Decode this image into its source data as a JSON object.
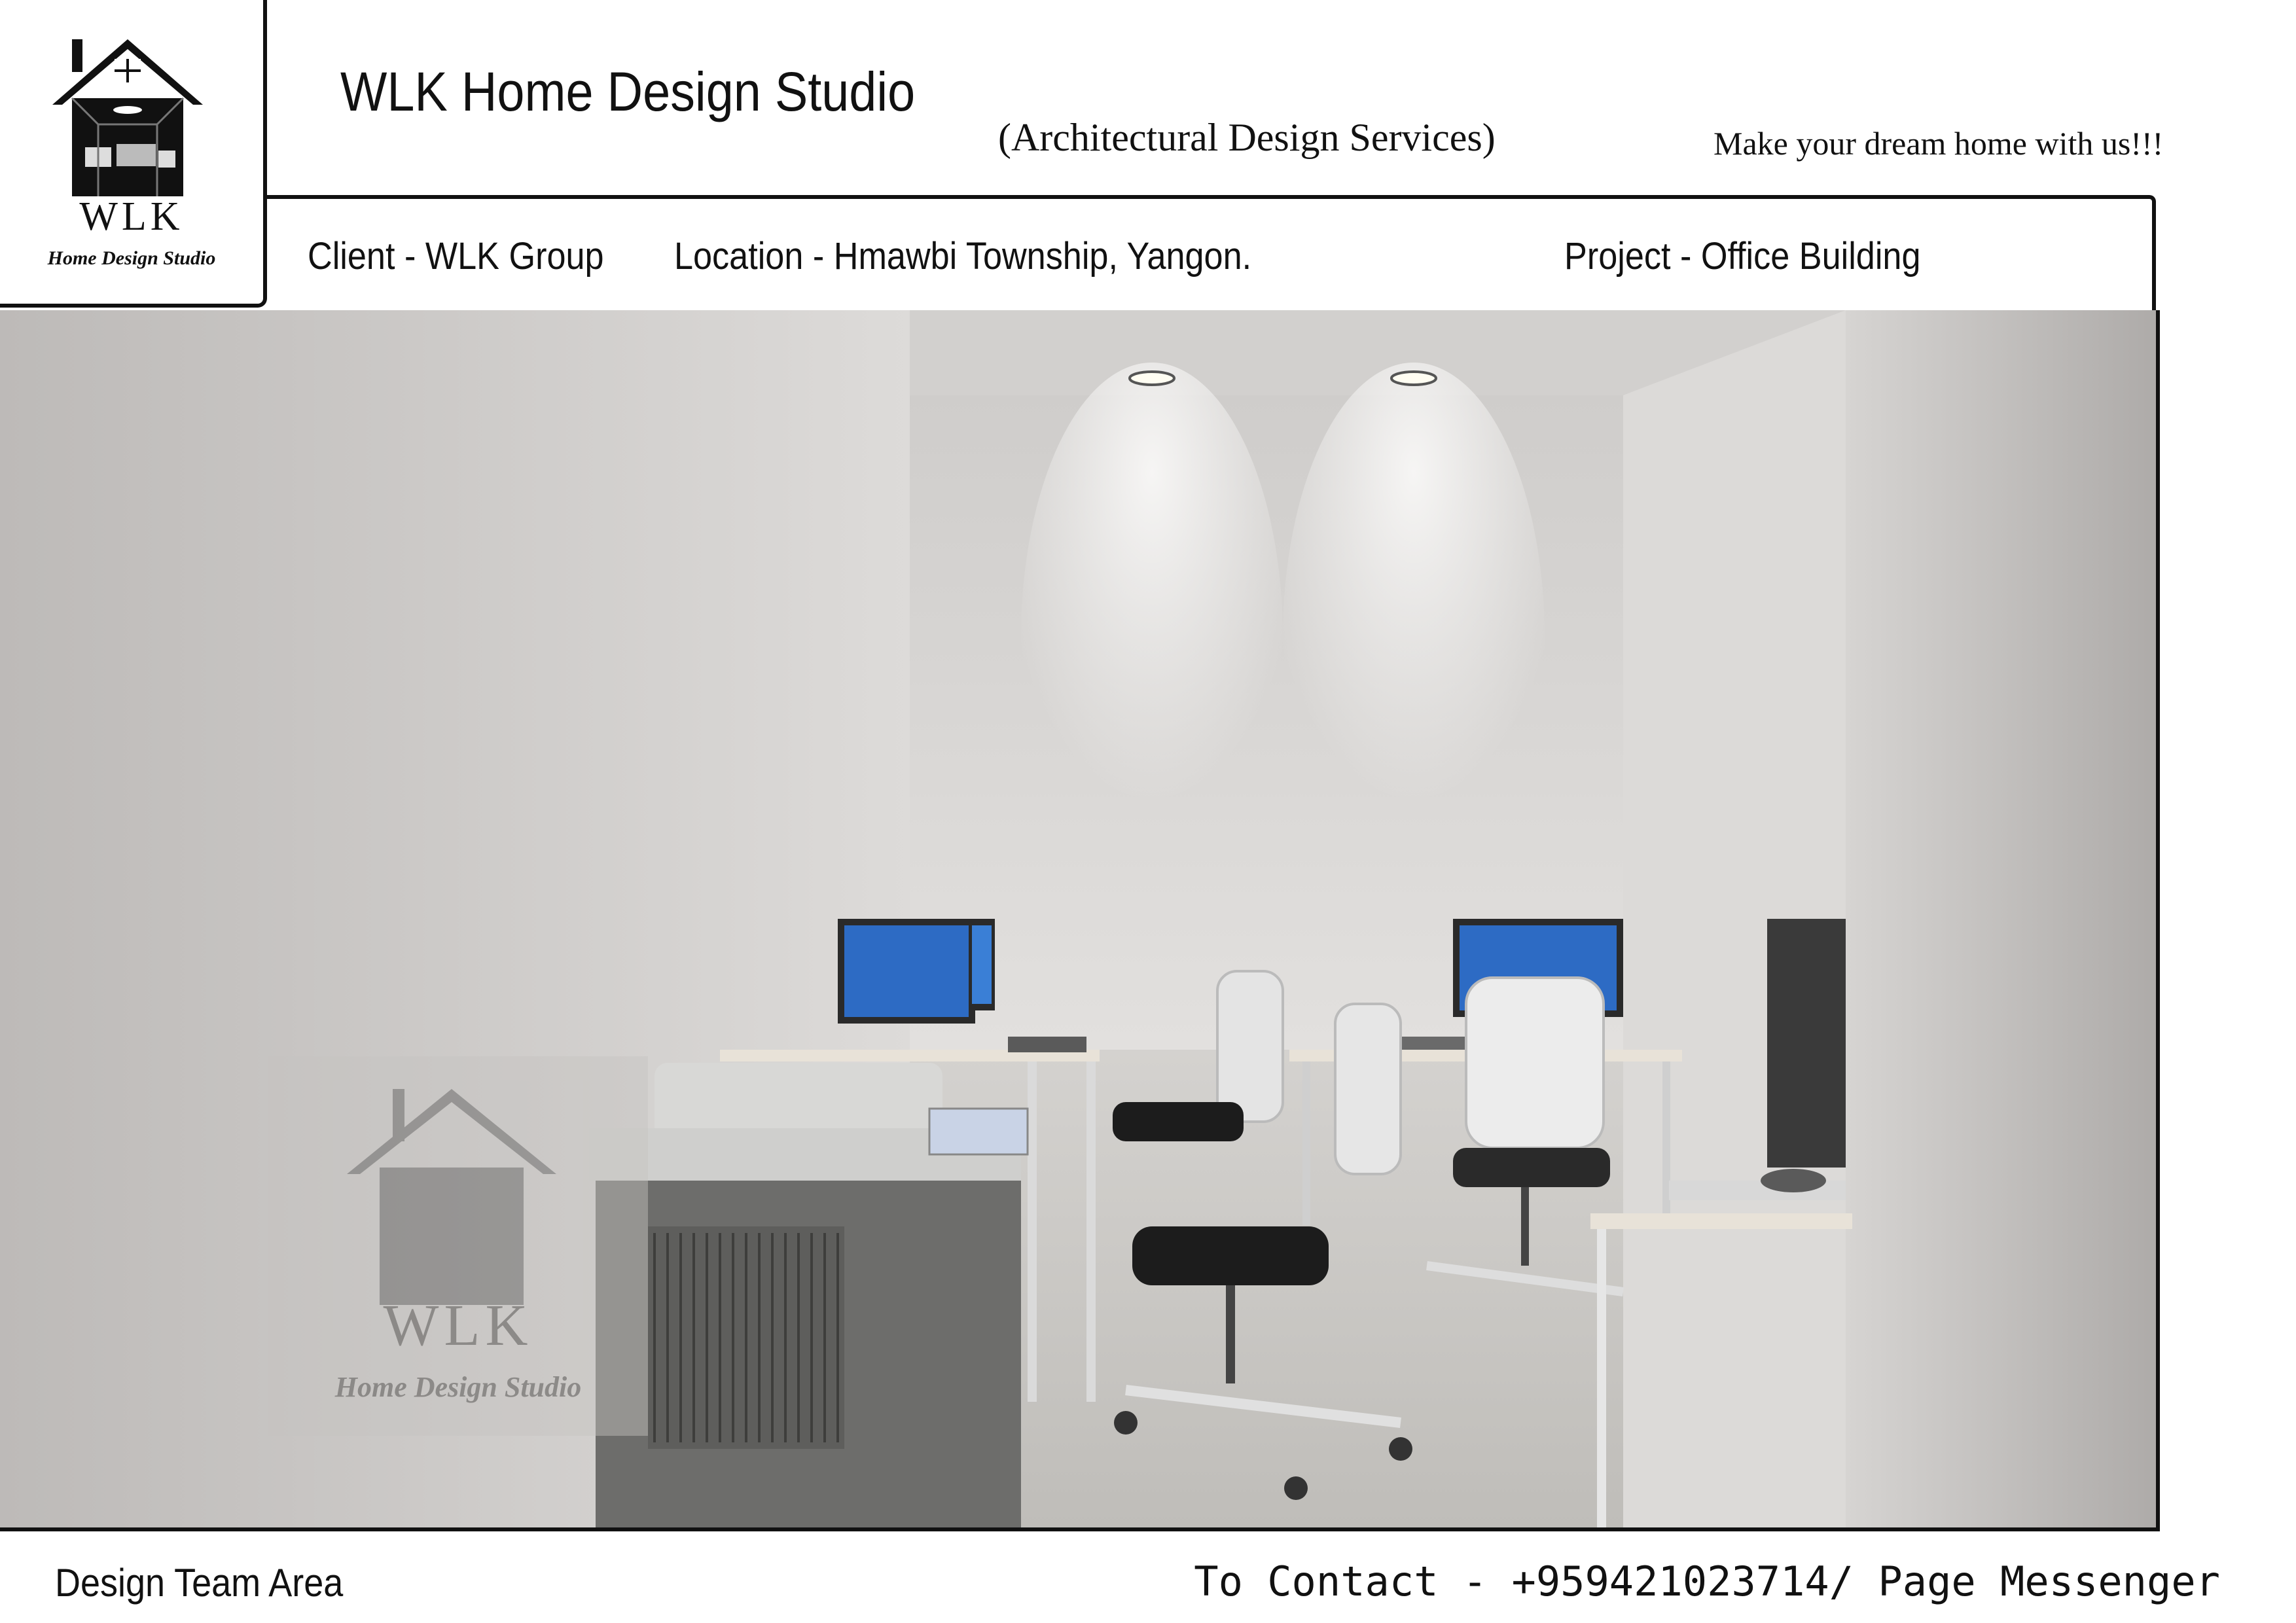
{
  "logo": {
    "name": "house-logo-icon",
    "wordmark": "WLK",
    "subtitle": "Home Design Studio"
  },
  "header": {
    "studio_name": "WLK Home Design Studio",
    "services": "(Architectural Design Services)",
    "tagline": "Make your dream home with us!!!"
  },
  "info_bar": {
    "client": "Client - WLK Group",
    "location": "Location - Hmawbi Township, Yangon.",
    "project": "Project - Office Building"
  },
  "render": {
    "name": "office-interior-render",
    "watermark": {
      "name": "wlk-watermark-logo",
      "wordmark": "WLK",
      "subtitle": "Home Design Studio"
    }
  },
  "footer": {
    "caption": "Design Team Area",
    "contact": "To Contact - +959421023714/ Page Messenger"
  },
  "colors": {
    "border": "#111111",
    "wall": "#d9d7d6",
    "floor": "#c8c6c3"
  }
}
